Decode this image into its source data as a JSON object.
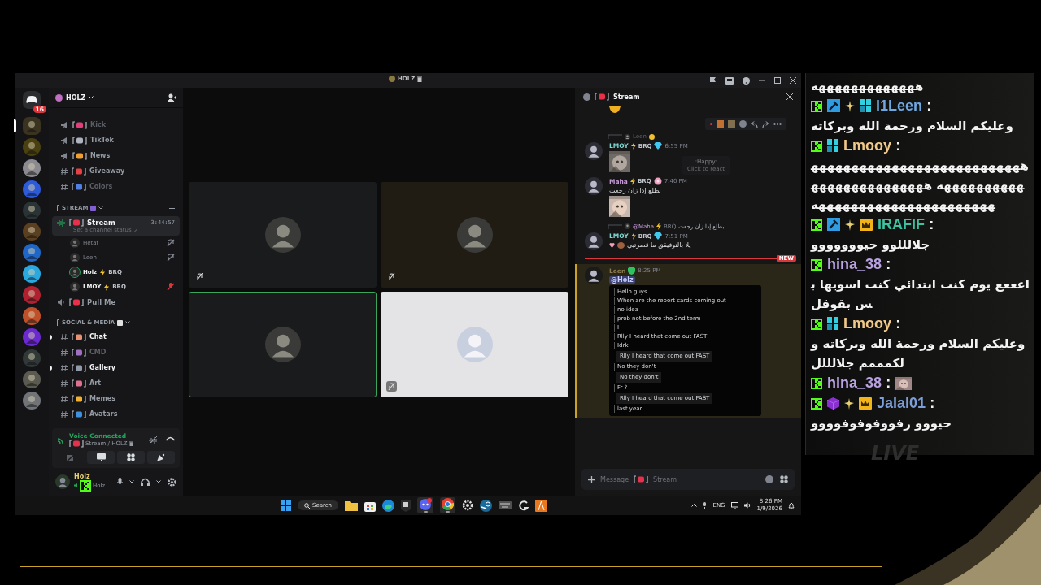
{
  "window": {
    "title": "HOLZ"
  },
  "home": {
    "badge": "16"
  },
  "servers": [
    {
      "selected": true,
      "color": "#3a3320"
    },
    {
      "selected": false,
      "color": "#4a4010"
    },
    {
      "selected": false,
      "color": "#8a8a90"
    },
    {
      "selected": false,
      "color": "#2c5ad8"
    },
    {
      "selected": false,
      "color": "#2a3436"
    },
    {
      "selected": false,
      "color": "#5a4020"
    },
    {
      "selected": false,
      "color": "#1e66c8"
    },
    {
      "selected": false,
      "color": "#2aa8e0"
    },
    {
      "selected": false,
      "color": "#b02030"
    },
    {
      "selected": false,
      "color": "#c0502a"
    },
    {
      "selected": false,
      "color": "#6a2ad0"
    },
    {
      "selected": false,
      "color": "#303838"
    },
    {
      "selected": false,
      "color": "#5a5a50"
    },
    {
      "selected": false,
      "color": "#707478"
    }
  ],
  "server": {
    "name": "HOLZ"
  },
  "channels": [
    {
      "kind": "announcement",
      "name": "Kick",
      "color": "#e0407a",
      "muted": true,
      "unread": false
    },
    {
      "kind": "announcement",
      "name": "TikTok",
      "color": "#b0b4c0",
      "muted": false,
      "unread": false
    },
    {
      "kind": "announcement",
      "name": "News",
      "color": "#f0a030",
      "muted": false,
      "unread": false
    },
    {
      "kind": "text",
      "name": "Giveaway",
      "color": "#e84040",
      "muted": false,
      "unread": false
    },
    {
      "kind": "text",
      "name": "Colors",
      "color": "#5080e0",
      "muted": true,
      "unread": false
    },
    {
      "kind": "category",
      "name": "STREAM",
      "color": "#8060d0"
    },
    {
      "kind": "voice",
      "name": "Stream",
      "color": "#e8304a",
      "selected": true,
      "time": "3:44:57",
      "status": "Set a channel status",
      "members": [
        {
          "name": "Hetaf",
          "muted": true,
          "server_muted": false,
          "speaking": false
        },
        {
          "name": "Leen",
          "muted": true,
          "server_muted": false,
          "speaking": false
        },
        {
          "name": "Holz",
          "tag": "BRQ",
          "muted": false,
          "server_muted": false,
          "speaking": true
        },
        {
          "name": "LMOY",
          "tag": "BRQ",
          "muted": false,
          "server_muted": true,
          "speaking": false
        }
      ]
    },
    {
      "kind": "voice",
      "name": "Pull Me",
      "color": "#e8304a",
      "selected": false
    },
    {
      "kind": "category",
      "name": "SOCIAL & MEDIA",
      "color": "#e0e0e0"
    },
    {
      "kind": "text",
      "name": "Chat",
      "color": "#e89070",
      "muted": false,
      "unread": true
    },
    {
      "kind": "text",
      "name": "CMD",
      "color": "#a070c0",
      "muted": true,
      "unread": false
    },
    {
      "kind": "text",
      "name": "Gallery",
      "color": "#909aa8",
      "muted": false,
      "unread": true
    },
    {
      "kind": "text",
      "name": "Art",
      "color": "#e07090",
      "muted": false,
      "unread": false
    },
    {
      "kind": "text",
      "name": "Memes",
      "color": "#f0b030",
      "muted": false,
      "unread": false
    },
    {
      "kind": "text",
      "name": "Avatars",
      "color": "#4090e0",
      "muted": false,
      "unread": false
    }
  ],
  "voice_panel": {
    "status": "Voice Connected",
    "channel": "Stream / HOLZ"
  },
  "user": {
    "name": "Holz",
    "sub": "Holz"
  },
  "tiles": [
    {
      "color": "#1a1b1c",
      "speaking": false,
      "muted": true
    },
    {
      "color": "#201c14",
      "speaking": false,
      "muted": true
    },
    {
      "color": "#1a1b1c",
      "speaking": true,
      "muted": false
    },
    {
      "color": "#e4e4e6",
      "speaking": false,
      "muted": true
    }
  ],
  "chat": {
    "title": "Stream",
    "placeholder": "Message",
    "channel": "Stream",
    "messages": [
      {
        "kind": "sticker"
      },
      {
        "kind": "message",
        "highlighted": false,
        "reply": {
          "author": "Leen"
        },
        "author": "LMOY",
        "color": "#7fd8d0",
        "tag": "BRQ",
        "badge": {
          "kind": "diamond"
        },
        "time": "6:55 PM",
        "tooltip": {
          "name": ":Happy:",
          "hint": "Click to react"
        }
      },
      {
        "kind": "message",
        "highlighted": false,
        "author": "Maha",
        "color": "#c79bd9",
        "tag": "BRQ",
        "badge": {
          "kind": "flower"
        },
        "time": "7:40 PM",
        "text": "بطلع إذا زان رجعت"
      },
      {
        "kind": "message",
        "highlighted": false,
        "reply": {
          "author": "@Maha",
          "tag": "BRQ",
          "text": "بطلع إذا زان رجعت"
        },
        "author": "LMOY",
        "color": "#7fd8d0",
        "tag": "BRQ",
        "badge": {
          "kind": "diamond"
        },
        "time": "7:51 PM",
        "text": "يلا بالتوفيقق ما قصرتيي"
      },
      {
        "kind": "divider",
        "label": "NEW"
      },
      {
        "kind": "message",
        "highlighted": true,
        "author": "Leen",
        "color": "#8a7a50",
        "badge": {
          "kind": "shield"
        },
        "time": "8:25 PM",
        "mention": "@Holz",
        "attachment": {
          "kind": "screenshot",
          "lines": [
            {
              "kind": "text",
              "text": "Hello guys"
            },
            {
              "kind": "text",
              "text": "When are the report cards coming out"
            },
            {
              "kind": "text",
              "text": "no idea"
            },
            {
              "kind": "text",
              "text": "prob not before the 2nd term"
            },
            {
              "kind": "text",
              "text": "I"
            },
            {
              "kind": "text",
              "text": "Rlly I heard that come out FAST"
            },
            {
              "kind": "text",
              "text": "Idrk"
            },
            {
              "kind": "quote",
              "text": "Rlly I heard that come out FAST"
            },
            {
              "kind": "text",
              "text": "No they don't"
            },
            {
              "kind": "quote",
              "text": "No they don't"
            },
            {
              "kind": "text",
              "text": "Fr ?"
            },
            {
              "kind": "quote",
              "text": "Rlly I heard that come out FAST"
            },
            {
              "kind": "text",
              "text": "last year"
            }
          ]
        }
      }
    ]
  },
  "stream_chat": {
    "overlay_label": "LIVE",
    "messages": [
      {
        "kind": "continuation",
        "text": "هههههههههههههه"
      },
      {
        "kind": "message",
        "badges": [
          {
            "kind": "kick"
          },
          {
            "kind": "mod"
          },
          {
            "kind": "bits"
          },
          {
            "kind": "og"
          }
        ],
        "user": "l1Leen",
        "separator": ":",
        "color": "#6fa8e0",
        "text": "وعليكم السلام ورحمة الله وبركاته"
      },
      {
        "kind": "message",
        "badges": [
          {
            "kind": "kick"
          },
          {
            "kind": "og"
          }
        ],
        "user": "Lmooy",
        "separator": ":",
        "color": "#f0c88a",
        "text": "هههههههههههههههههههههههههههههههههههههه هههههههههههههههههههههههههههههههههههههه"
      },
      {
        "kind": "message",
        "badges": [
          {
            "kind": "kick"
          },
          {
            "kind": "mod"
          },
          {
            "kind": "bits"
          },
          {
            "kind": "crown"
          }
        ],
        "user": "IRAFIF",
        "separator": ":",
        "color": "#3ec1a0",
        "text": "جلالللوو حيووووووو"
      },
      {
        "kind": "message",
        "badges": [
          {
            "kind": "kick"
          }
        ],
        "user": "hina_38",
        "separator": ":",
        "color": "#b9a3e3",
        "text": "اعععع يوم كنت ابتدائي كنت اسويها بس بقوقل"
      },
      {
        "kind": "message",
        "badges": [
          {
            "kind": "kick"
          },
          {
            "kind": "og"
          }
        ],
        "user": "Lmooy",
        "separator": ":",
        "color": "#f0c88a",
        "text": "وعليكم السلام ورحمة الله وبركاته ولكمممم جلالللل"
      },
      {
        "kind": "message",
        "badges": [
          {
            "kind": "kick"
          }
        ],
        "user": "hina_38",
        "separator": ":",
        "color": "#b9a3e3",
        "emote": true
      },
      {
        "kind": "message",
        "badges": [
          {
            "kind": "kick"
          },
          {
            "kind": "cube"
          },
          {
            "kind": "bits"
          },
          {
            "kind": "crown"
          }
        ],
        "user": "Jalal01",
        "separator": ":",
        "color": "#7d9fd9",
        "text": "حيووو رفووفوفوفوووو"
      }
    ]
  },
  "taskbar": {
    "search": "Search",
    "apps": [
      {
        "kind": "explorer",
        "active": false
      },
      {
        "kind": "store",
        "active": false
      },
      {
        "kind": "edge",
        "active": false
      },
      {
        "kind": "epic",
        "active": false
      },
      {
        "kind": "discord",
        "active": true
      },
      {
        "kind": "chrome",
        "active": true
      },
      {
        "kind": "steelseries",
        "active": false
      },
      {
        "kind": "steam",
        "active": false
      },
      {
        "kind": "keyboard",
        "active": false
      },
      {
        "kind": "logitech",
        "active": false
      },
      {
        "kind": "orange",
        "active": false
      }
    ],
    "language": "ENG",
    "time": "8:26 PM",
    "date": "1/9/2026"
  }
}
